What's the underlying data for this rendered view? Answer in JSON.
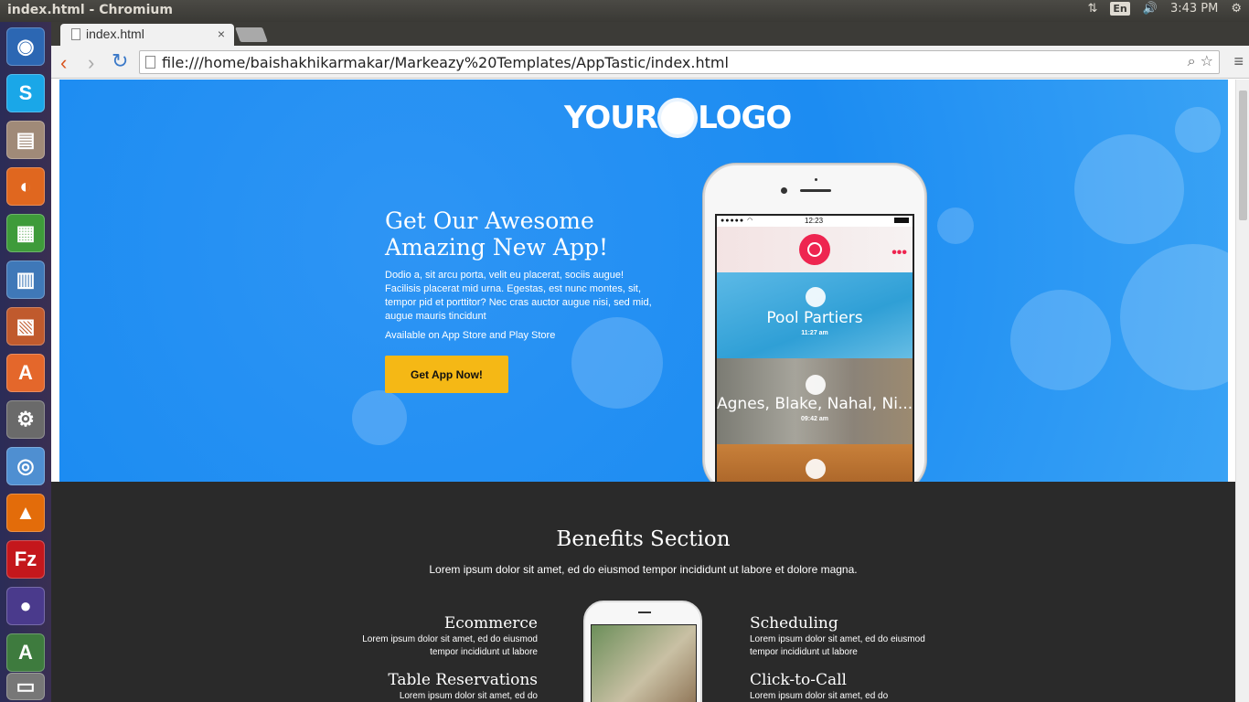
{
  "window": {
    "title": "index.html - Chromium",
    "clock": "3:43 PM",
    "lang": "En"
  },
  "tabs": [
    {
      "label": "index.html"
    }
  ],
  "address_bar": {
    "url": "file:///home/baishakhikarmakar/Markeazy%20Templates/AppTastic/index.html"
  },
  "hero": {
    "logo_left": "YOUR",
    "logo_right": "LOGO",
    "headline": "Get Our Awesome Amazing New App!",
    "description": "Dodio a, sit arcu porta, velit eu placerat, sociis augue! Facilisis placerat mid urna. Egestas, est nunc montes, sit, tempor pid et porttitor? Nec cras auctor augue nisi, sed mid, augue mauris tincidunt",
    "availability": "Available on App Store and Play Store",
    "cta_label": "Get App Now!",
    "accent_color": "#1c8cf2",
    "cta_color": "#f5b815"
  },
  "phone": {
    "time": "12:23",
    "cards": [
      {
        "name": "Pool Partiers",
        "time": "11:27 am"
      },
      {
        "name": "Agnes, Blake, Nahal, Ni...",
        "time": "09:42 am"
      }
    ]
  },
  "benefits": {
    "title": "Benefits Section",
    "subtitle": "Lorem ipsum dolor sit amet, ed do eiusmod tempor incididunt ut labore et dolore magna.",
    "features": [
      {
        "title": "Ecommerce",
        "desc": "Lorem ipsum dolor sit amet, ed do eiusmod tempor incididunt ut labore"
      },
      {
        "title": "Scheduling",
        "desc": "Lorem ipsum dolor sit amet, ed do eiusmod tempor incididunt ut labore"
      },
      {
        "title": "Table Reservations",
        "desc": "Lorem ipsum dolor sit amet, ed do"
      },
      {
        "title": "Click-to-Call",
        "desc": "Lorem ipsum dolor sit amet, ed do"
      }
    ],
    "background_color": "#2a2a2a"
  },
  "launcher": {
    "icons": [
      "ubuntu-icon",
      "skype-icon",
      "files-icon",
      "firefox-icon",
      "calc-icon",
      "writer-icon",
      "impress-icon",
      "software-center-icon",
      "settings-icon",
      "chromium-icon",
      "vlc-icon",
      "filezilla-icon",
      "eclipse-icon",
      "updater-icon",
      "trash-icon"
    ]
  }
}
